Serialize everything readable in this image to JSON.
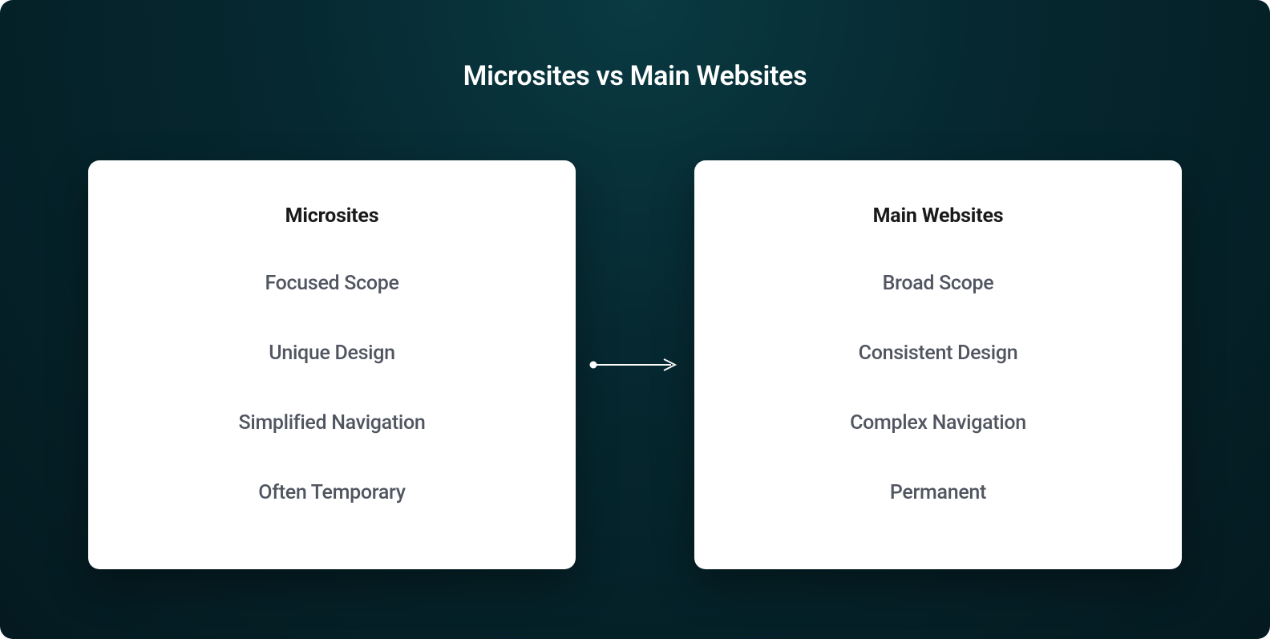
{
  "title": "Microsites vs Main Websites",
  "leftCard": {
    "heading": "Microsites",
    "items": [
      "Focused Scope",
      "Unique Design",
      "Simplified Navigation",
      "Often Temporary"
    ]
  },
  "rightCard": {
    "heading": "Main Websites",
    "items": [
      "Broad Scope",
      "Consistent Design",
      "Complex Navigation",
      "Permanent"
    ]
  }
}
